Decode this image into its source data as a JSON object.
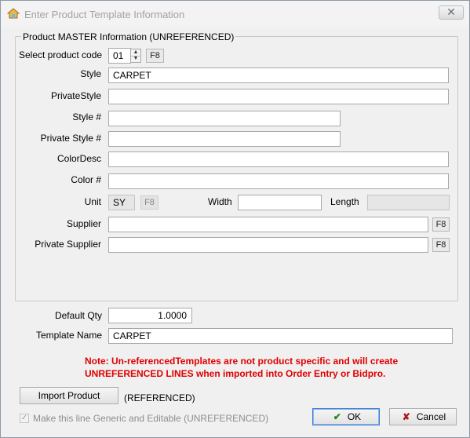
{
  "window": {
    "title": "Enter Product Template Information",
    "close_glyph": "✕"
  },
  "group": {
    "title": "Product MASTER Information (UNREFERENCED)"
  },
  "product_code": {
    "label": "Select product code",
    "value": "01",
    "f8": "F8"
  },
  "style": {
    "label": "Style",
    "value": "CARPET"
  },
  "private_style": {
    "label": "PrivateStyle",
    "value": ""
  },
  "style_num": {
    "label": "Style #",
    "value": ""
  },
  "private_style_num": {
    "label": "Private Style #",
    "value": ""
  },
  "color_desc": {
    "label": "ColorDesc",
    "value": ""
  },
  "color_num": {
    "label": "Color #",
    "value": ""
  },
  "unit": {
    "label": "Unit",
    "value": "SY",
    "f8": "F8"
  },
  "width": {
    "label": "Width",
    "value": ""
  },
  "length": {
    "label": "Length",
    "value": ""
  },
  "supplier": {
    "label": "Supplier",
    "value": "",
    "f8": "F8"
  },
  "private_supplier": {
    "label": "Private Supplier",
    "value": "",
    "f8": "F8"
  },
  "default_qty": {
    "label": "Default Qty",
    "value": "1.0000"
  },
  "template_name": {
    "label": "Template Name",
    "value": "CARPET"
  },
  "note": {
    "line1": "Note: Un-referencedTemplates are not product specific and will create",
    "line2": "UNREFERENCED LINES when imported into Order Entry or Bidpro."
  },
  "import": {
    "button_label": "Import Product",
    "referenced_label": "(REFERENCED)"
  },
  "generic": {
    "label": "Make this line Generic and Editable (UNREFERENCED)",
    "checked": true
  },
  "buttons": {
    "ok": "OK",
    "cancel": "Cancel"
  },
  "colors": {
    "note_red": "#e00000",
    "ok_green": "#1a8a1a",
    "cancel_red": "#b01818",
    "focus_blue": "#3a7bd5"
  }
}
